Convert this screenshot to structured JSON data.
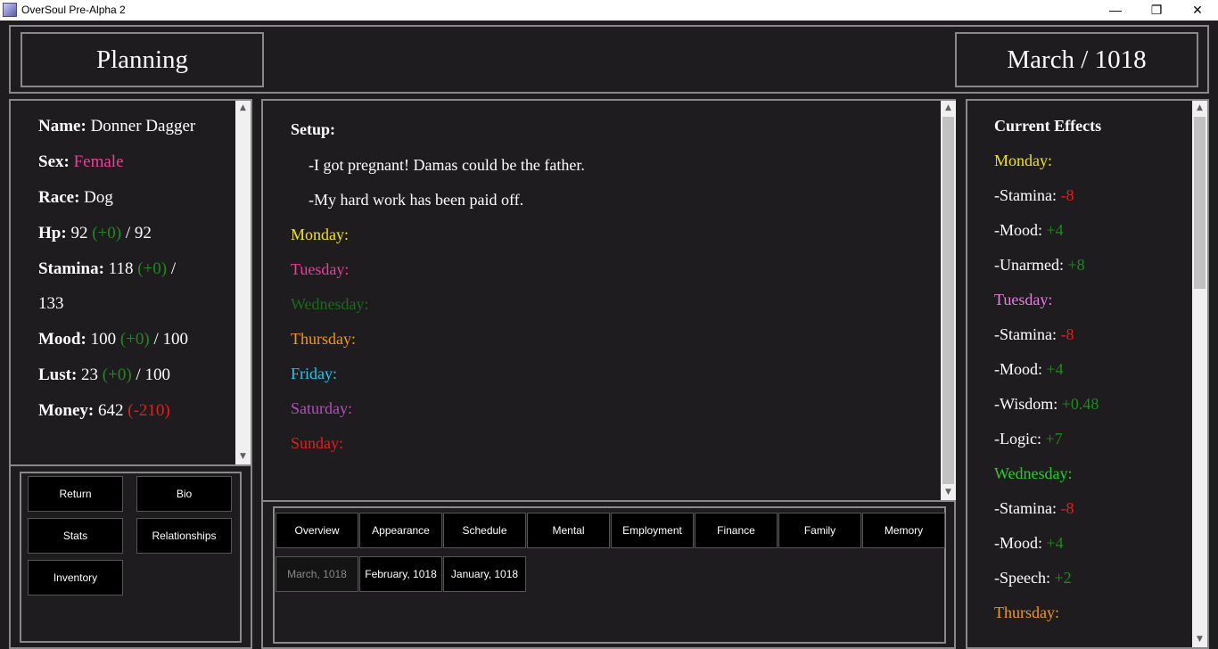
{
  "window": {
    "title": "OverSoul Pre-Alpha 2",
    "minimize": "—",
    "maximize": "❐",
    "close": "✕"
  },
  "header": {
    "left_title": "Planning",
    "right_title": "March / 1018"
  },
  "character": {
    "name_label": "Name:",
    "name": "Donner Dagger",
    "sex_label": "Sex:",
    "sex": "Female",
    "race_label": "Race:",
    "race": "Dog",
    "hp_label": "Hp:",
    "hp": "92",
    "hp_delta": "(+0)",
    "hp_max": "/ 92",
    "stamina_label": "Stamina:",
    "stamina": "118",
    "stamina_delta": "(+0)",
    "stamina_slash": "/",
    "stamina_max": "133",
    "mood_label": "Mood:",
    "mood": "100",
    "mood_delta": "(+0)",
    "mood_max": "/ 100",
    "lust_label": "Lust:",
    "lust": "23",
    "lust_delta": "(+0)",
    "lust_max": "/ 100",
    "money_label": "Money:",
    "money": "642",
    "money_delta": "(-210)"
  },
  "nav_buttons": {
    "return": "Return",
    "bio": "Bio",
    "stats": "Stats",
    "relationships": "Relationships",
    "inventory": "Inventory"
  },
  "planning": {
    "setup_label": "Setup:",
    "setup_lines": [
      "-I got pregnant! Damas could be the father.",
      "-My hard work has been paid off."
    ],
    "days": [
      {
        "label": "Monday:",
        "color": "#f2e600"
      },
      {
        "label": "Tuesday:",
        "color": "#ee3e9a"
      },
      {
        "label": "Wednesday:",
        "color": "#1c6a1c"
      },
      {
        "label": "Thursday:",
        "color": "#f39a10"
      },
      {
        "label": "Friday:",
        "color": "#1ec8e8"
      },
      {
        "label": "Saturday:",
        "color": "#b44ec0"
      },
      {
        "label": "Sunday:",
        "color": "#e0201c"
      }
    ]
  },
  "tabs": [
    "Overview",
    "Appearance",
    "Schedule",
    "Mental",
    "Employment",
    "Finance",
    "Family",
    "Memory"
  ],
  "months": [
    "March, 1018",
    "February, 1018",
    "January, 1018"
  ],
  "effects": {
    "title": "Current Effects",
    "lines": [
      {
        "label": "Monday:",
        "color": "#f2e600"
      },
      {
        "label": "-Stamina:",
        "value": "-8",
        "vcolor": "#e0201c"
      },
      {
        "label": "-Mood:",
        "value": "+4",
        "vcolor": "#1e8a1e"
      },
      {
        "label": "-Unarmed:",
        "value": "+8",
        "vcolor": "#1e8a1e"
      },
      {
        "label": "Tuesday:",
        "color": "#e57fe0"
      },
      {
        "label": "-Stamina:",
        "value": "-8",
        "vcolor": "#e0201c"
      },
      {
        "label": "-Mood:",
        "value": "+4",
        "vcolor": "#1e8a1e"
      },
      {
        "label": "-Wisdom:",
        "value": "+0.48",
        "vcolor": "#1e8a1e"
      },
      {
        "label": "-Logic:",
        "value": "+7",
        "vcolor": "#1e8a1e"
      },
      {
        "label": "Wednesday:",
        "color": "#22d022"
      },
      {
        "label": "-Stamina:",
        "value": "-8",
        "vcolor": "#e0201c"
      },
      {
        "label": "-Mood:",
        "value": "+4",
        "vcolor": "#1e8a1e"
      },
      {
        "label": "-Speech:",
        "value": "+2",
        "vcolor": "#1e8a1e"
      },
      {
        "label": "Thursday:",
        "color": "#f39a10"
      }
    ]
  }
}
